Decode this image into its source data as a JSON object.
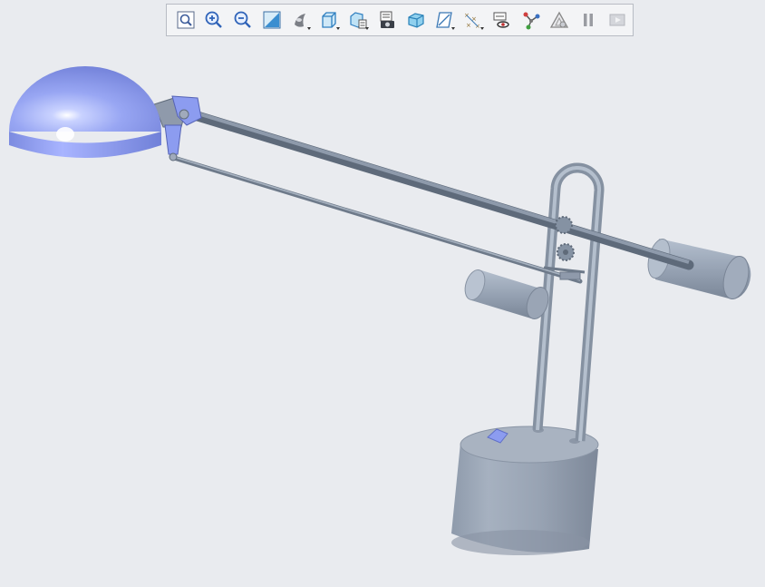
{
  "viewport": {
    "background": "#e9ebef",
    "model": "desk-lamp-assembly"
  },
  "toolbar": {
    "buttons": [
      {
        "name": "refit-button",
        "icon": "refit-icon",
        "dropdown": false
      },
      {
        "name": "zoom-in-button",
        "icon": "zoom-in-icon",
        "dropdown": false
      },
      {
        "name": "zoom-out-button",
        "icon": "zoom-out-icon",
        "dropdown": false
      },
      {
        "name": "repaint-button",
        "icon": "repaint-icon",
        "dropdown": false
      },
      {
        "name": "display-style-button",
        "icon": "display-style-icon",
        "dropdown": true
      },
      {
        "name": "saved-orientations-button",
        "icon": "view-cube-icon",
        "dropdown": true
      },
      {
        "name": "view-manager-button",
        "icon": "view-manager-icon",
        "dropdown": true
      },
      {
        "name": "section-button",
        "icon": "section-camera-icon",
        "dropdown": false
      },
      {
        "name": "perspective-view-button",
        "icon": "perspective-icon",
        "dropdown": false
      },
      {
        "name": "datum-display-button",
        "icon": "datum-plane-icon",
        "dropdown": true
      },
      {
        "name": "annotation-display-button",
        "icon": "datum-points-icon",
        "dropdown": true
      },
      {
        "name": "spin-center-button",
        "icon": "spin-center-icon",
        "dropdown": false
      },
      {
        "name": "connection-button",
        "icon": "connection-icon",
        "dropdown": false
      },
      {
        "name": "simplified-rep-button",
        "icon": "triangle-rep-icon",
        "dropdown": false
      },
      {
        "name": "pause-button",
        "icon": "pause-icon",
        "dropdown": false
      },
      {
        "name": "next-button",
        "icon": "next-icon",
        "dropdown": false
      }
    ]
  },
  "colors": {
    "shade_blue": "#8c9cf0",
    "metal": "#a3aebd",
    "metal_dark": "#6c7888",
    "toolbar_bg": "#f3f4f6"
  }
}
